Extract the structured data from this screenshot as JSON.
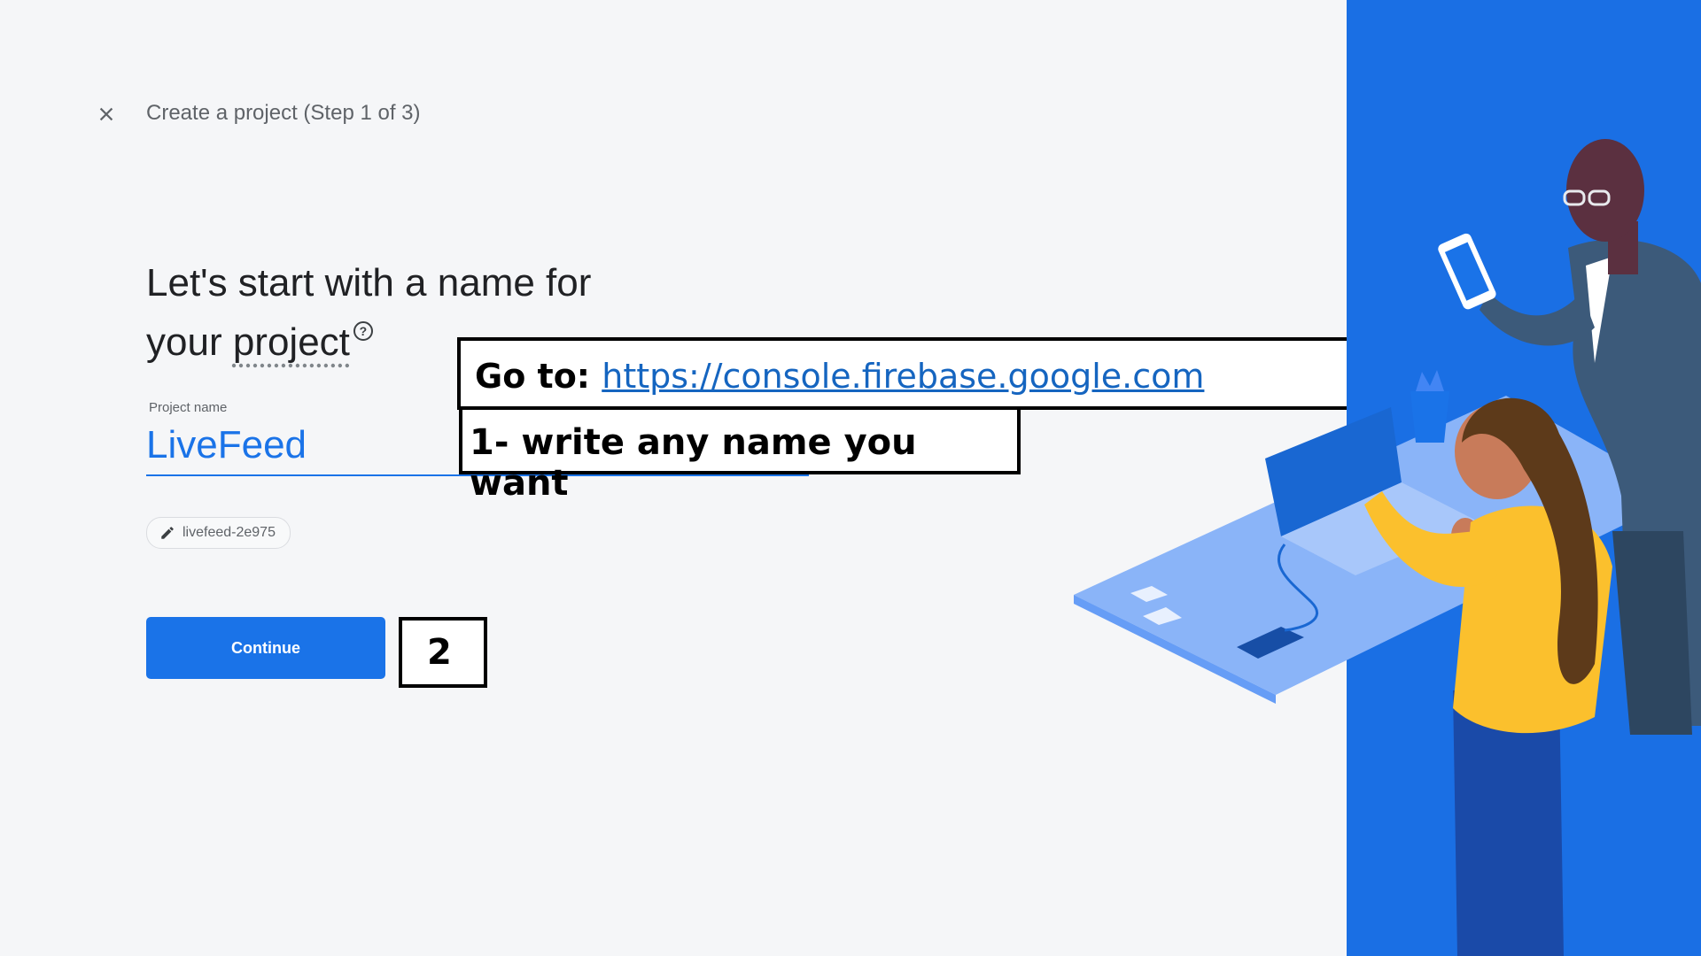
{
  "header": {
    "title": "Create a project (Step 1 of 3)",
    "close_icon": "close-icon"
  },
  "main": {
    "headline_line1": "Let's start with a name for",
    "headline_your": "your ",
    "headline_project": "project",
    "help_glyph": "?",
    "project_name_label": "Project name",
    "project_name_value": "LiveFeed",
    "project_id": "livefeed-2e975",
    "continue_label": "Continue"
  },
  "annotations": {
    "goto_prefix": "Go to: ",
    "goto_link": "https://console.firebase.google.com",
    "name_hint": "1- write any name you want",
    "step_number": "2"
  },
  "colors": {
    "accent": "#1a73e8",
    "panel": "#1a6fe4",
    "background": "#f5f6f8"
  }
}
